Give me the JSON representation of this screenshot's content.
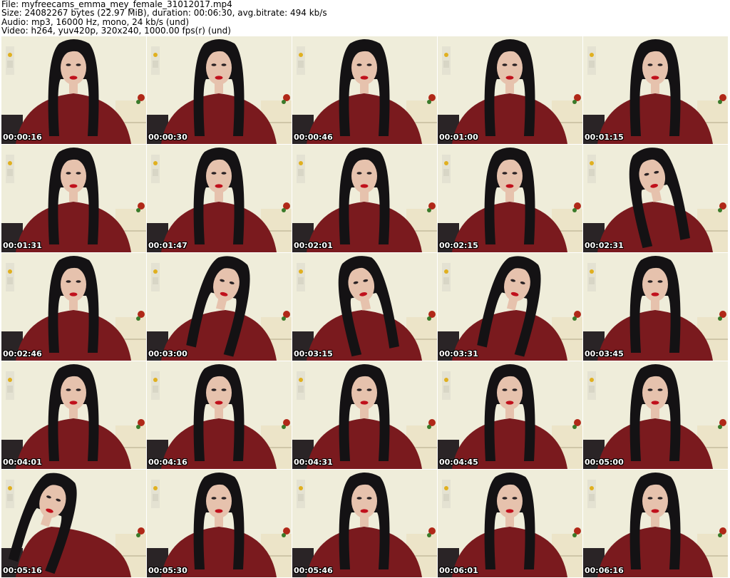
{
  "header": {
    "file_line": "File: myfreecams_emma_mey_female_31012017.mp4",
    "size_line": "Size: 24082267 bytes (22.97 MiB), duration: 00:06:30, avg.bitrate: 494 kb/s",
    "audio_line": "Audio: mp3, 16000 Hz, mono, 24 kb/s (und)",
    "video_line": "Video: h264, yuv420p, 320x240, 1000.00 fps(r) (und)"
  },
  "frames": [
    {
      "time": "00:00:16",
      "pose": "center"
    },
    {
      "time": "00:00:30",
      "pose": "center"
    },
    {
      "time": "00:00:46",
      "pose": "center"
    },
    {
      "time": "00:01:00",
      "pose": "center"
    },
    {
      "time": "00:01:15",
      "pose": "center"
    },
    {
      "time": "00:01:31",
      "pose": "center"
    },
    {
      "time": "00:01:47",
      "pose": "center"
    },
    {
      "time": "00:02:01",
      "pose": "center"
    },
    {
      "time": "00:02:15",
      "pose": "center"
    },
    {
      "time": "00:02:31",
      "pose": "tilt"
    },
    {
      "time": "00:02:46",
      "pose": "center"
    },
    {
      "time": "00:03:00",
      "pose": "turned"
    },
    {
      "time": "00:03:15",
      "pose": "tilt"
    },
    {
      "time": "00:03:31",
      "pose": "turned"
    },
    {
      "time": "00:03:45",
      "pose": "center"
    },
    {
      "time": "00:04:01",
      "pose": "center"
    },
    {
      "time": "00:04:16",
      "pose": "center"
    },
    {
      "time": "00:04:31",
      "pose": "center"
    },
    {
      "time": "00:04:45",
      "pose": "center"
    },
    {
      "time": "00:05:00",
      "pose": "center"
    },
    {
      "time": "00:05:16",
      "pose": "profile"
    },
    {
      "time": "00:05:30",
      "pose": "center"
    },
    {
      "time": "00:05:46",
      "pose": "center"
    },
    {
      "time": "00:06:01",
      "pose": "center"
    },
    {
      "time": "00:06:16",
      "pose": "center"
    }
  ],
  "colors": {
    "wall": "#efedda",
    "shirt": "#7a1a1e",
    "hair": "#141214",
    "skin": "#e6c2ad",
    "lips": "#c0101c",
    "timestamp_text": "#ffffff"
  }
}
